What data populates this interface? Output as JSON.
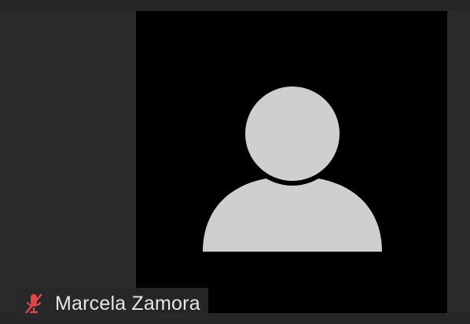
{
  "participant": {
    "name": "Marcela Zamora",
    "audio_muted": true,
    "video_enabled": false
  },
  "icons": {
    "avatar": "person-silhouette-icon",
    "mic": "microphone-muted-icon"
  },
  "colors": {
    "tile_background": "#2a2a2a",
    "video_background": "#000000",
    "avatar_fill": "#cfcfcf",
    "muted_icon": "#e0474c",
    "name_text": "#e6e6e6"
  }
}
